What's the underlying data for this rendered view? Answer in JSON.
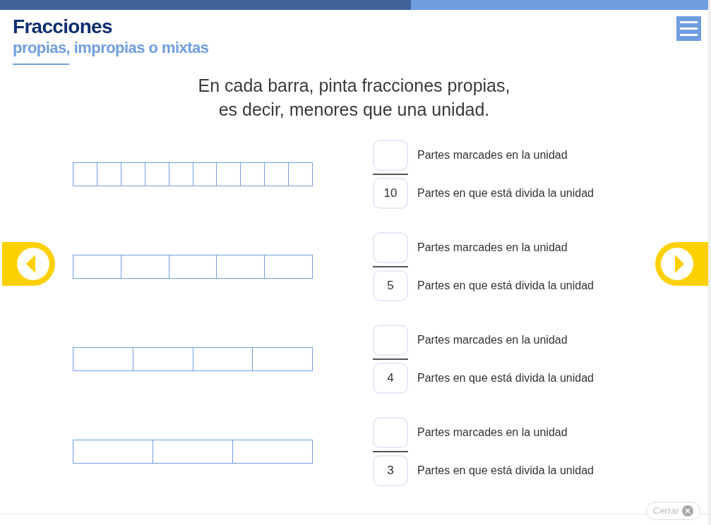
{
  "progress": {
    "level": 0.58
  },
  "header": {
    "title": "Fracciones",
    "subtitle": "propias, impropias o mixtas"
  },
  "instruction": [
    "En cada barra, pinta fracciones propias,",
    "es decir, menores que una unidad."
  ],
  "exercises": [
    {
      "segments": [
        {
          "painted": false
        },
        {
          "painted": false
        },
        {
          "painted": false
        },
        {
          "painted": false
        },
        {
          "painted": false
        },
        {
          "painted": false
        },
        {
          "painted": false
        },
        {
          "painted": false
        },
        {
          "painted": false
        },
        {
          "painted": false
        }
      ],
      "numerator": {
        "label": "Partes marcades en la unidad"
      },
      "denominator": {
        "value": "10",
        "label": "Partes en que está divida la unidad"
      }
    },
    {
      "segments": [
        {
          "painted": false
        },
        {
          "painted": false
        },
        {
          "painted": false
        },
        {
          "painted": false
        },
        {
          "painted": false
        }
      ],
      "numerator": {
        "label": "Partes marcades en la unidad"
      },
      "denominator": {
        "value": "5",
        "label": "Partes en que está divida la unidad"
      }
    },
    {
      "segments": [
        {
          "painted": false
        },
        {
          "painted": false
        },
        {
          "painted": false
        },
        {
          "painted": false
        }
      ],
      "numerator": {
        "label": "Partes marcades en la unidad"
      },
      "denominator": {
        "value": "4",
        "label": "Partes en que está divida la unidad"
      }
    },
    {
      "segments": [
        {
          "painted": false
        },
        {
          "painted": false
        },
        {
          "painted": false
        }
      ],
      "numerator": {
        "label": "Partes marcades en la unidad"
      },
      "denominator": {
        "value": "3",
        "label": "Partes en que está divida la unidad"
      }
    }
  ],
  "close_button": {
    "label": "Cerrar"
  }
}
